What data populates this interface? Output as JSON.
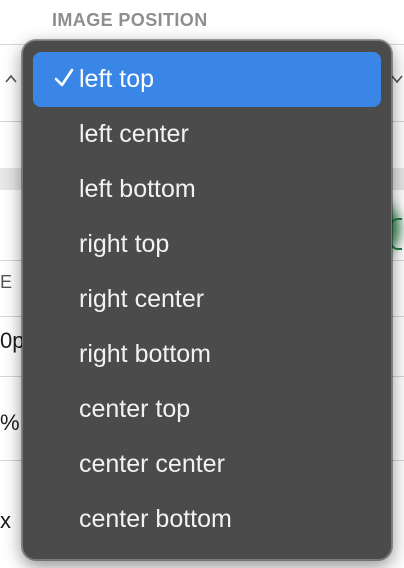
{
  "panel": {
    "section_label": "IMAGE POSITION",
    "fragments": {
      "e": "E",
      "p": "0p",
      "pct": "%",
      "x": "x"
    }
  },
  "dropdown": {
    "selected_index": 0,
    "items": [
      {
        "label": "left top",
        "selected": true
      },
      {
        "label": "left center",
        "selected": false
      },
      {
        "label": "left bottom",
        "selected": false
      },
      {
        "label": "right top",
        "selected": false
      },
      {
        "label": "right center",
        "selected": false
      },
      {
        "label": "right bottom",
        "selected": false
      },
      {
        "label": "center top",
        "selected": false
      },
      {
        "label": "center center",
        "selected": false
      },
      {
        "label": "center bottom",
        "selected": false
      }
    ]
  },
  "colors": {
    "menu_background": "#4b4b4b",
    "selection_accent": "#3a86e6",
    "menu_text": "#f2f2f2",
    "section_label": "#8e8e8e"
  },
  "icons": {
    "selected_marker": "checkmark-icon"
  }
}
